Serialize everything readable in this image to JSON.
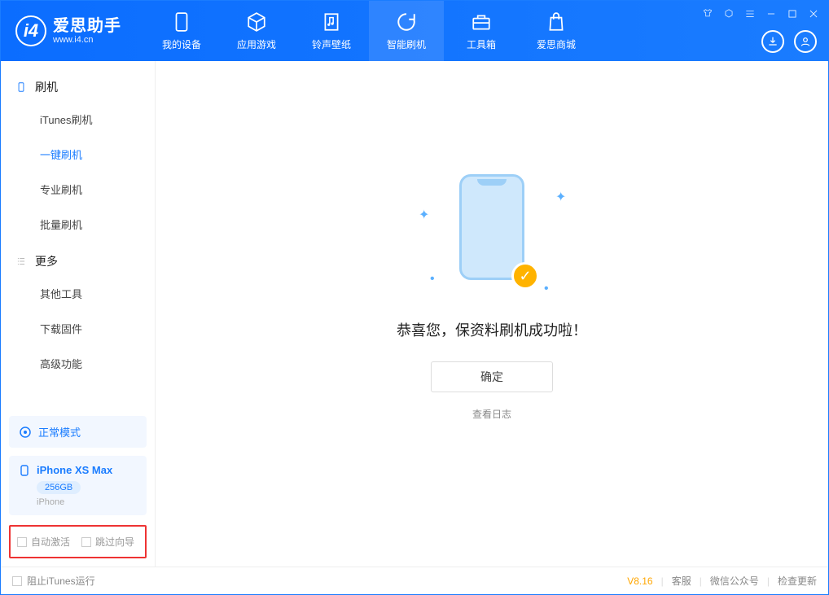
{
  "app": {
    "title": "爱思助手",
    "subtitle": "www.i4.cn"
  },
  "tabs": [
    {
      "label": "我的设备",
      "icon": "device-icon"
    },
    {
      "label": "应用游戏",
      "icon": "cube-icon"
    },
    {
      "label": "铃声壁纸",
      "icon": "music-icon"
    },
    {
      "label": "智能刷机",
      "icon": "refresh-icon",
      "active": true
    },
    {
      "label": "工具箱",
      "icon": "toolbox-icon"
    },
    {
      "label": "爱思商城",
      "icon": "bag-icon"
    }
  ],
  "titlebar": [
    "tshirt-icon",
    "cube-sm-icon",
    "menu-icon",
    "minimize-icon",
    "maximize-icon",
    "close-icon"
  ],
  "header_actions": [
    "download-icon",
    "user-icon"
  ],
  "sidebar": {
    "groups": [
      {
        "title": "刷机",
        "icon": "phone-icon",
        "items": [
          {
            "label": "iTunes刷机"
          },
          {
            "label": "一键刷机",
            "active": true
          },
          {
            "label": "专业刷机"
          },
          {
            "label": "批量刷机"
          }
        ]
      },
      {
        "title": "更多",
        "icon": "list-icon",
        "items": [
          {
            "label": "其他工具"
          },
          {
            "label": "下载固件"
          },
          {
            "label": "高级功能"
          }
        ]
      }
    ],
    "mode": "正常模式",
    "device": {
      "name": "iPhone XS Max",
      "storage": "256GB",
      "type": "iPhone"
    },
    "options": [
      {
        "label": "自动激活"
      },
      {
        "label": "跳过向导"
      }
    ]
  },
  "main": {
    "message": "恭喜您，保资料刷机成功啦！",
    "ok": "确定",
    "loglink": "查看日志"
  },
  "status": {
    "block_itunes": "阻止iTunes运行",
    "version": "V8.16",
    "links": [
      "客服",
      "微信公众号",
      "检查更新"
    ]
  }
}
